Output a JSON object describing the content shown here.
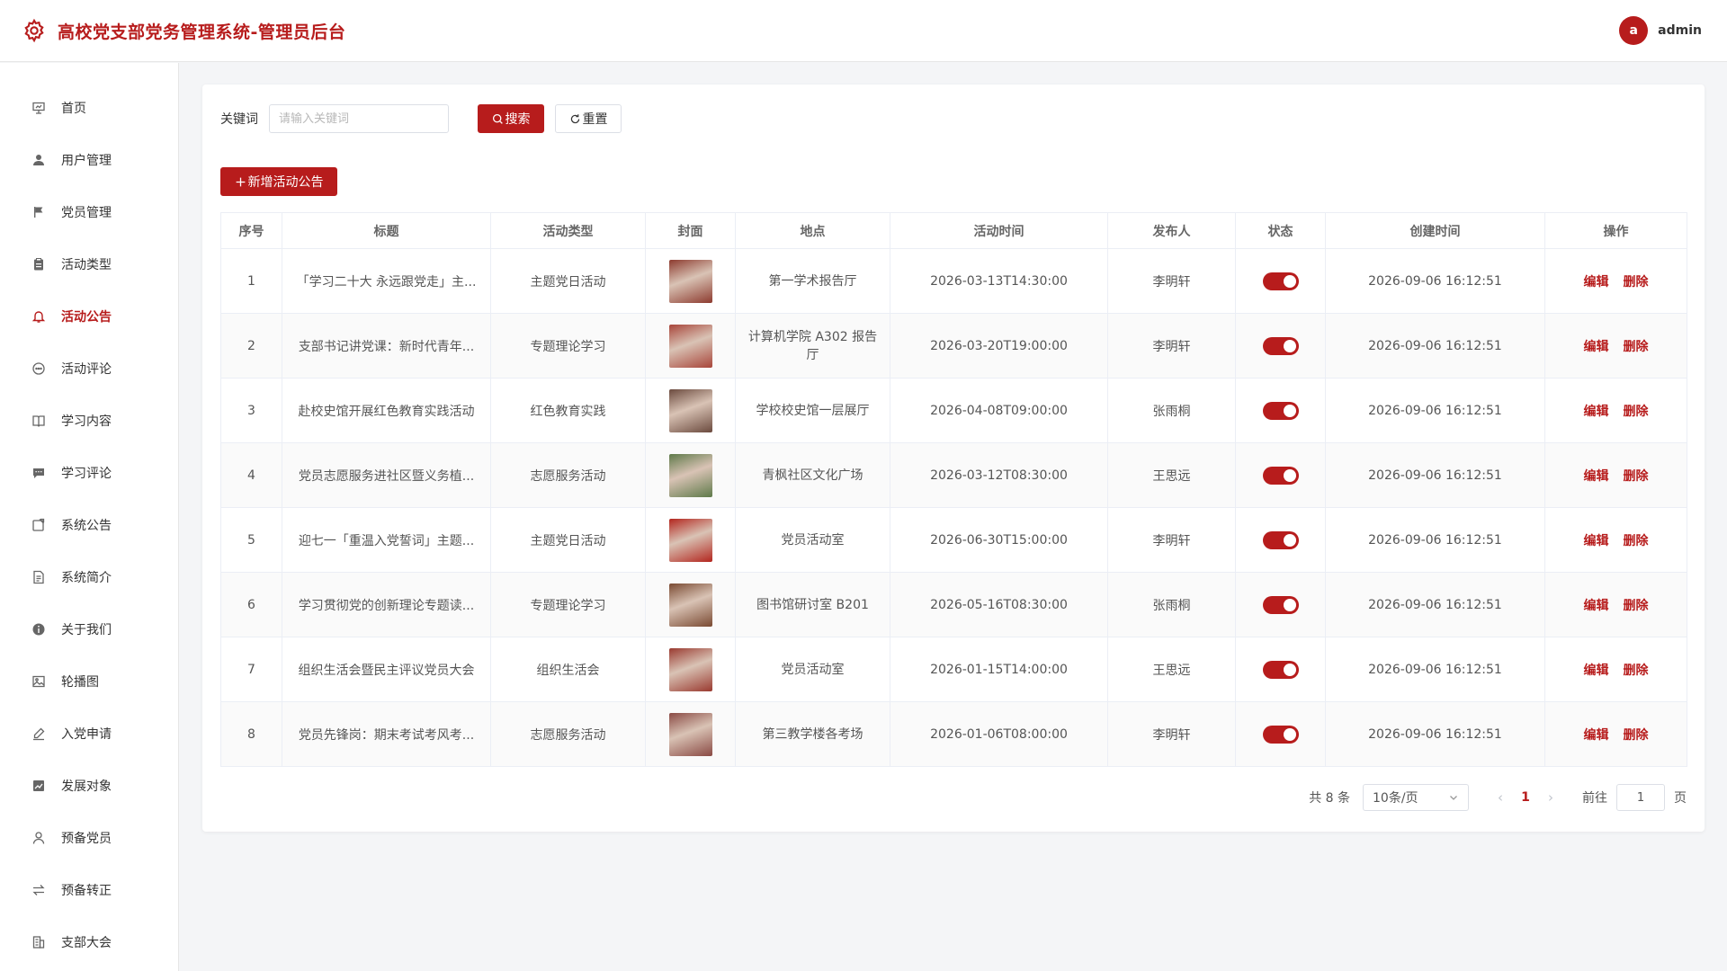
{
  "header": {
    "title": "高校党支部党务管理系统-管理员后台",
    "avatar_letter": "a",
    "username": "admin"
  },
  "colors": {
    "brand": "#b71c1c",
    "background": "#f4f5f7"
  },
  "sidebar": {
    "active_index": 4,
    "items": [
      {
        "label": "首页",
        "icon": "presentation-icon"
      },
      {
        "label": "用户管理",
        "icon": "user-icon"
      },
      {
        "label": "党员管理",
        "icon": "flag-icon"
      },
      {
        "label": "活动类型",
        "icon": "clipboard-icon"
      },
      {
        "label": "活动公告",
        "icon": "bell-icon"
      },
      {
        "label": "活动评论",
        "icon": "chat-bubble-icon"
      },
      {
        "label": "学习内容",
        "icon": "book-icon"
      },
      {
        "label": "学习评论",
        "icon": "comment-icon"
      },
      {
        "label": "系统公告",
        "icon": "notice-icon"
      },
      {
        "label": "系统简介",
        "icon": "document-icon"
      },
      {
        "label": "关于我们",
        "icon": "info-icon"
      },
      {
        "label": "轮播图",
        "icon": "picture-icon"
      },
      {
        "label": "入党申请",
        "icon": "pen-icon"
      },
      {
        "label": "发展对象",
        "icon": "chart-icon"
      },
      {
        "label": "预备党员",
        "icon": "person-outline-icon"
      },
      {
        "label": "预备转正",
        "icon": "switch-arrows-icon"
      },
      {
        "label": "支部大会",
        "icon": "building-icon"
      }
    ]
  },
  "search": {
    "label": "关键词",
    "placeholder": "请输入关键词",
    "search_label": "搜索",
    "reset_label": "重置"
  },
  "toolbar": {
    "add_label": "新增活动公告"
  },
  "table": {
    "columns": [
      "序号",
      "标题",
      "活动类型",
      "封面",
      "地点",
      "活动时间",
      "发布人",
      "状态",
      "创建时间",
      "操作"
    ],
    "edit_label": "编辑",
    "delete_label": "删除",
    "rows": [
      {
        "no": "1",
        "title": "「学习二十大 永远跟党走」主...",
        "type": "主题党日活动",
        "cover": "#8d3b2f",
        "place": "第一学术报告厅",
        "time": "2026-03-13T14:30:00",
        "publisher": "李明轩",
        "status": true,
        "created": "2026-09-06 16:12:51"
      },
      {
        "no": "2",
        "title": "支部书记讲党课：新时代青年...",
        "type": "专题理论学习",
        "cover": "#a8453a",
        "place": "计算机学院 A302 报告厅",
        "time": "2026-03-20T19:00:00",
        "publisher": "李明轩",
        "status": true,
        "created": "2026-09-06 16:12:51"
      },
      {
        "no": "3",
        "title": "赴校史馆开展红色教育实践活动",
        "type": "红色教育实践",
        "cover": "#6b4a3e",
        "place": "学校校史馆一层展厅",
        "time": "2026-04-08T09:00:00",
        "publisher": "张雨桐",
        "status": true,
        "created": "2026-09-06 16:12:51"
      },
      {
        "no": "4",
        "title": "党员志愿服务进社区暨义务植...",
        "type": "志愿服务活动",
        "cover": "#5f7a4a",
        "place": "青枫社区文化广场",
        "time": "2026-03-12T08:30:00",
        "publisher": "王思远",
        "status": true,
        "created": "2026-09-06 16:12:51"
      },
      {
        "no": "5",
        "title": "迎七一「重温入党誓词」主题...",
        "type": "主题党日活动",
        "cover": "#b3261e",
        "place": "党员活动室",
        "time": "2026-06-30T15:00:00",
        "publisher": "李明轩",
        "status": true,
        "created": "2026-09-06 16:12:51"
      },
      {
        "no": "6",
        "title": "学习贯彻党的创新理论专题读...",
        "type": "专题理论学习",
        "cover": "#7a4a32",
        "place": "图书馆研讨室 B201",
        "time": "2026-05-16T08:30:00",
        "publisher": "张雨桐",
        "status": true,
        "created": "2026-09-06 16:12:51"
      },
      {
        "no": "7",
        "title": "组织生活会暨民主评议党员大会",
        "type": "组织生活会",
        "cover": "#9a3a30",
        "place": "党员活动室",
        "time": "2026-01-15T14:00:00",
        "publisher": "王思远",
        "status": true,
        "created": "2026-09-06 16:12:51"
      },
      {
        "no": "8",
        "title": "党员先锋岗：期末考试考风考...",
        "type": "志愿服务活动",
        "cover": "#8a4a44",
        "place": "第三教学楼各考场",
        "time": "2026-01-06T08:00:00",
        "publisher": "李明轩",
        "status": true,
        "created": "2026-09-06 16:12:51"
      }
    ]
  },
  "pagination": {
    "total_label": "共 8 条",
    "page_size_label": "10条/页",
    "current_page": "1",
    "goto_label": "前往",
    "goto_value": "1",
    "page_unit": "页"
  }
}
